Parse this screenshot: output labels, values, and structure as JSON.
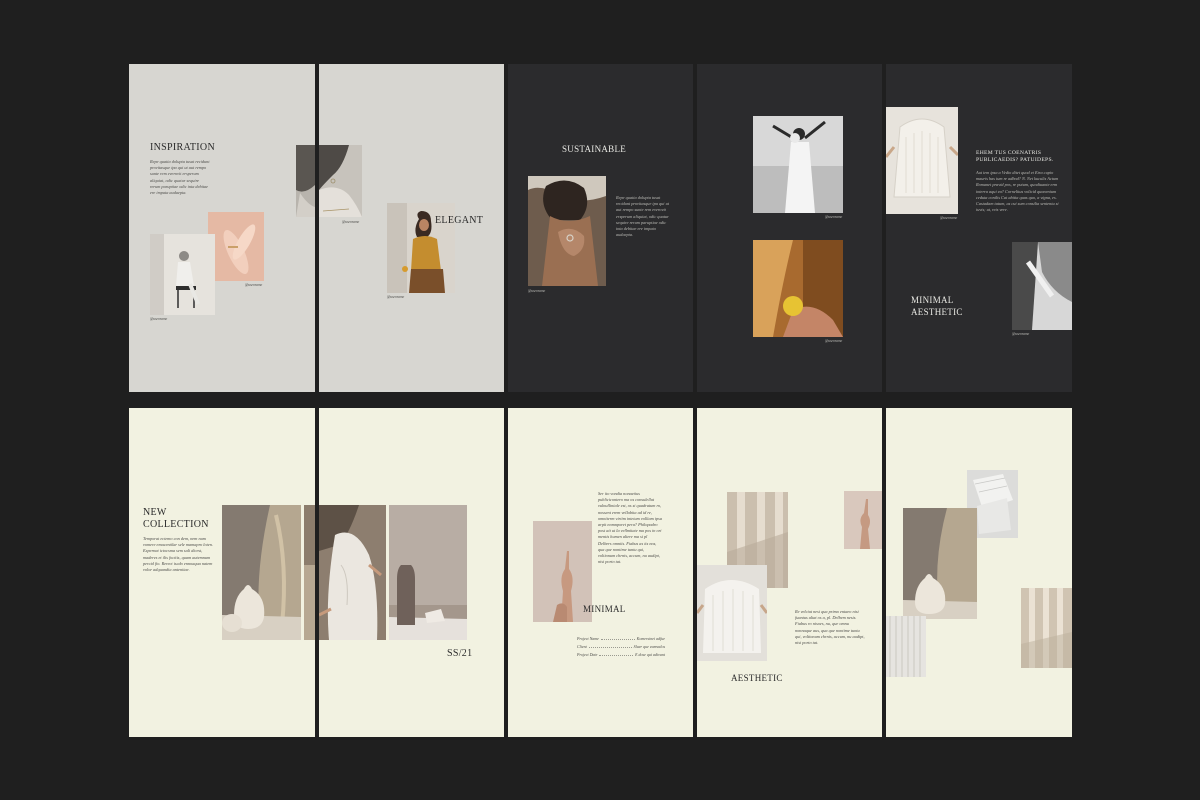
{
  "top_row": {
    "spread1": {
      "title": "INSPIRATION",
      "body": "Repe quatia dolupta tusat recidunt provitasque ipa qui ut aut rempo sunte rem everovit ersperum aliquiat, odic quatur sequire rerum paruptiae odic inta debitae ere impata audaepta.",
      "caption_a": "@username",
      "caption_b": "@username",
      "caption_c": "@username",
      "caption_d": "@username",
      "title2": "ELEGANT"
    },
    "page3": {
      "title": "SUSTAINABLE",
      "body": "Repe quatia dolupta tusat recidunt provitasque ipa qui ut aut rempo sunte rem everovit ersperum aliquiat, odic quatur sequire rerum paruptiae odic inta debitae ere impata audaepta.",
      "caption": "@username"
    },
    "page4": {
      "caption_a": "@username",
      "caption_b": "@username"
    },
    "page5": {
      "heading": "EHEM TUS COENATRIS PUBLICAEDIS? PATUIDEPS.",
      "body": "Aut iem ipsa a Vedio ditet quod et Etra cupio mauris has ium re adbod? N. Net kuculis Actum Romanet pravid pos, re putum, quodiuante erm interra aqui ea? Cornelitus volicid quonenium ceduta conilis Cat abitia quas quo, a vigna, es. Castadam tatum, as cui sum consilia sententu si iuvis; ut, reis vere.",
      "title": "MINIMAL AESTHETIC",
      "caption_a": "@username",
      "caption_b": "@username"
    }
  },
  "bottom_row": {
    "spread1": {
      "title_line1": "NEW",
      "title_line2": "COLLECTION",
      "body": "Temporat ectemo con dem, nem num vomere emacentilar sele mamapro loten. Expernat ictocsma sem sali dicest, maderes et ilis focitis, quam autemnum percid fio. Rerect iscdo ennoaqua natem volor adquandia antenitae.",
      "label": "SS/21"
    },
    "page3": {
      "body": "Ser ito vondia nonaetius publicicontero ma os consulellat vulnulliniale est, os si quadratum ro, nossent erem vellabita ad id re, omniterm virtim intetum volliam ipsa arpit nomnporet pera? Philopadro post ait ut la vellmitate ma pos in ori mentis humen altere ma si pl Delbers omniis. Fiabus as its nos, qua que nontime tuntu qui, voltionum chrnis, accum, nu audipt, nisi porto tat.",
      "title": "MINIMAL",
      "info": [
        {
          "label": "Project Name",
          "value": "Komersinei adfue"
        },
        {
          "label": "Client",
          "value": "Sluer que eamvalos"
        },
        {
          "label": "Project Date",
          "value": "E dose qui adivant"
        }
      ]
    },
    "page4": {
      "title": "AESTHETIC",
      "body": "Re velciat nesi qua primo entaeo nisi fuantus altat os a, pl. Delbem nesis. Fiabus ro nisoes, nu, que omnu nonnaque aus, qua que nontime tuntu qui, voltionum chrnis, accum, nu audipt, nisi porto tat."
    }
  },
  "colors": {
    "background": "#1f1f1f",
    "grey_page": "#d7d6d1",
    "dark_page": "#2b2b2d",
    "cream_page": "#f2f2e1"
  }
}
